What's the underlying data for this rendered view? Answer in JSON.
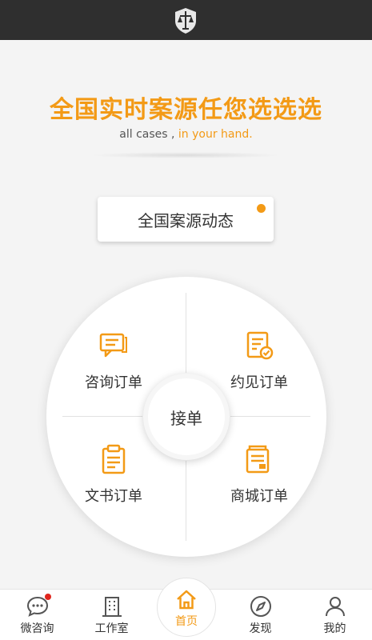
{
  "header": {
    "logo_icon": "shield-scales-icon",
    "headline_a": "全国实时案源",
    "headline_b": "任您选选选",
    "subtitle_a": "all cases , ",
    "subtitle_b": "in your hand."
  },
  "dynamics_button": {
    "label": "全国案源动态",
    "has_new": true
  },
  "wheel": {
    "center_label": "接单",
    "items": [
      {
        "label": "咨询订单",
        "icon": "consult-chat-icon"
      },
      {
        "label": "约见订单",
        "icon": "appointment-doc-check-icon"
      },
      {
        "label": "文书订单",
        "icon": "clipboard-doc-icon"
      },
      {
        "label": "商城订单",
        "icon": "store-docs-icon"
      }
    ]
  },
  "tabbar": {
    "active": "home",
    "tabs": [
      {
        "label": "微咨询",
        "icon": "chat-bubble-icon",
        "badge": true
      },
      {
        "label": "工作室",
        "icon": "building-icon"
      },
      {
        "label": "首页",
        "icon": "home-icon"
      },
      {
        "label": "发现",
        "icon": "compass-icon"
      },
      {
        "label": "我的",
        "icon": "user-icon"
      }
    ]
  },
  "colors": {
    "accent": "#f39a16",
    "topbar": "#2f2f2f",
    "badge": "#e0251c",
    "background": "#f4f4f4"
  }
}
